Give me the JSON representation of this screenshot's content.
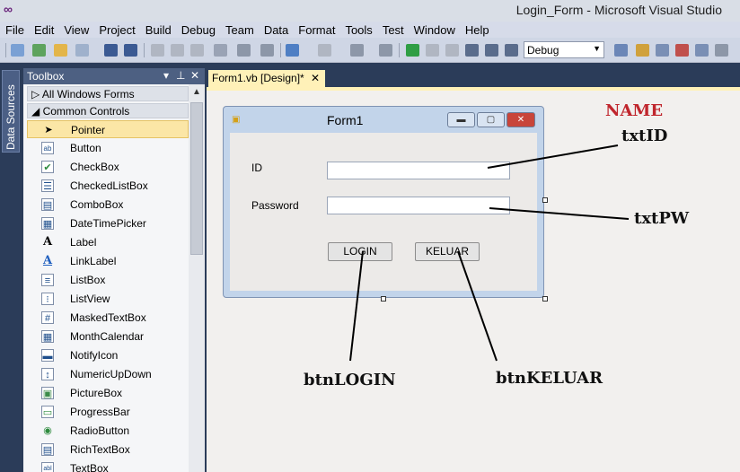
{
  "window": {
    "title": "Login_Form - Microsoft Visual Studio"
  },
  "menu": [
    "File",
    "Edit",
    "View",
    "Project",
    "Build",
    "Debug",
    "Team",
    "Data",
    "Format",
    "Tools",
    "Test",
    "Window",
    "Help"
  ],
  "toolbar": {
    "configuration": "Debug"
  },
  "side_tab": {
    "label": "Data Sources"
  },
  "toolbox": {
    "title": "Toolbox",
    "header_controls": {
      "dropdown": "▾",
      "pin": "⊥",
      "close": "✕"
    },
    "groups": [
      {
        "label": "All Windows Forms",
        "expander": "▷"
      },
      {
        "label": "Common Controls",
        "expander": "◢"
      }
    ],
    "items": [
      {
        "label": "Pointer",
        "icon": "pointer-icon",
        "glyph": "➤"
      },
      {
        "label": "Button",
        "icon": "button-icon",
        "glyph": "ab"
      },
      {
        "label": "CheckBox",
        "icon": "checkbox-icon",
        "glyph": "✔"
      },
      {
        "label": "CheckedListBox",
        "icon": "checkedlistbox-icon",
        "glyph": "☰"
      },
      {
        "label": "ComboBox",
        "icon": "combobox-icon",
        "glyph": "▤"
      },
      {
        "label": "DateTimePicker",
        "icon": "datetimepicker-icon",
        "glyph": "▦"
      },
      {
        "label": "Label",
        "icon": "label-icon",
        "glyph": "A"
      },
      {
        "label": "LinkLabel",
        "icon": "linklabel-icon",
        "glyph": "A"
      },
      {
        "label": "ListBox",
        "icon": "listbox-icon",
        "glyph": "≡"
      },
      {
        "label": "ListView",
        "icon": "listview-icon",
        "glyph": "⁝"
      },
      {
        "label": "MaskedTextBox",
        "icon": "maskedtextbox-icon",
        "glyph": "#"
      },
      {
        "label": "MonthCalendar",
        "icon": "monthcalendar-icon",
        "glyph": "▦"
      },
      {
        "label": "NotifyIcon",
        "icon": "notifyicon-icon",
        "glyph": "▬"
      },
      {
        "label": "NumericUpDown",
        "icon": "numericupdown-icon",
        "glyph": "↕"
      },
      {
        "label": "PictureBox",
        "icon": "picturebox-icon",
        "glyph": "▣"
      },
      {
        "label": "ProgressBar",
        "icon": "progressbar-icon",
        "glyph": "▭"
      },
      {
        "label": "RadioButton",
        "icon": "radiobutton-icon",
        "glyph": "◉"
      },
      {
        "label": "RichTextBox",
        "icon": "richtextbox-icon",
        "glyph": "▤"
      },
      {
        "label": "TextBox",
        "icon": "textbox-icon",
        "glyph": "abl"
      }
    ],
    "scroll_up": "▲"
  },
  "document": {
    "tab_label": "Form1.vb [Design]*",
    "tab_close": "✕"
  },
  "form": {
    "title": "Form1",
    "window_buttons": {
      "minimize": "▬",
      "maximize": "▢",
      "close": "✕"
    },
    "id_label": "ID",
    "password_label": "Password",
    "login_button": "LOGIN",
    "exit_button": "KELUAR"
  },
  "annotations": {
    "header": "NAME",
    "txtid": "txtID",
    "txtpw": "txtPW",
    "btnlogin": "btnLOGIN",
    "btnkeluar": "btnKELUAR"
  },
  "colors": {
    "vs_background": "#2b3c59",
    "toolbox_header": "#4d6082",
    "selected_item": "#fbe6a6",
    "doc_tab": "#fff1b8",
    "annotation_red": "#c0262d"
  }
}
